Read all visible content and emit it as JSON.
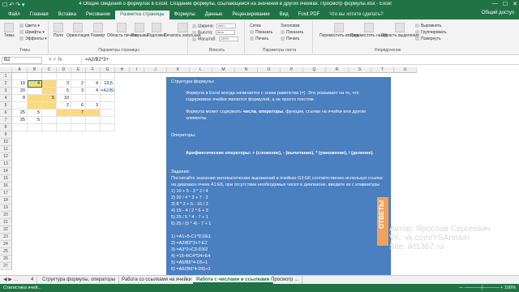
{
  "titlebar": {
    "title": "4 Общие сведения о формулах в Excel. Создание формулы, ссылающейся на значения в других ячейках. Просмотр формулы.xlsx - Excel",
    "quick_access": "☐ ↶ ↷ ▾",
    "min": "—",
    "max": "☐",
    "close": "✕"
  },
  "tabs": [
    "Файл",
    "Главная",
    "Вставка",
    "Рисование",
    "Разметка страницы",
    "Формулы",
    "Данные",
    "Рецензирование",
    "Вид",
    "Foxit PDF",
    "Что вы хотите сделать?"
  ],
  "active_tab_index": 4,
  "share": "Общий доступ",
  "ribbon": {
    "themes": {
      "label": "Темы",
      "buttons": [
        "Темы",
        "Цвета ▾",
        "Шрифты ▾",
        "Эффекты ▾"
      ]
    },
    "page_setup": {
      "label": "Параметры страницы",
      "buttons": [
        "Поля",
        "Ориентация",
        "Размер",
        "Область печати",
        "Разрывы",
        "Подложка",
        "Печатать заголовки"
      ]
    },
    "fit": {
      "label": "Вписать",
      "lines": [
        "Ширина:",
        "Высота:",
        "Масштаб:"
      ],
      "values": [
        "Авто",
        "Авто",
        "100%"
      ]
    },
    "sheet_options": {
      "label": "Параметры листа",
      "col1": [
        "Сетка",
        "Показать",
        "Печать"
      ],
      "col2": [
        "Заголовки",
        "Показать",
        "Печать"
      ]
    },
    "arrange": {
      "label": "Упорядочение",
      "buttons": [
        "Переместить вперед",
        "Переместить назад",
        "Область выделения",
        "Выровнять",
        "Группировать",
        "Повернуть"
      ]
    }
  },
  "formula_bar": {
    "name_box": "B2",
    "fx": "× ✓ fx",
    "formula": "=A2/B2*3+"
  },
  "columns": [
    "A",
    "B",
    "C",
    "D",
    "E",
    "F",
    "G",
    "H",
    "I",
    "J",
    "K",
    "L",
    "M",
    "N",
    "O",
    "P",
    "Q",
    "R",
    "S",
    "T",
    "U"
  ],
  "rows": [
    "1",
    "2",
    "3",
    "4",
    "5",
    "6",
    "7",
    "8",
    "9",
    "10",
    "11",
    "12",
    "13",
    "14",
    "15",
    "16",
    "17",
    "18",
    "19",
    "20",
    "21",
    "22",
    "23",
    "24",
    "25",
    "26",
    "27"
  ],
  "cells": {
    "A2": "10",
    "B2": "4",
    "D2": "3",
    "E2": "2",
    "F2": "4",
    "A3": "20",
    "D3": "5",
    "E3": "3",
    "F3": "4",
    "A4": "8",
    "C4": "5",
    "D4": "10",
    "D5": "2",
    "E5": "6",
    "F5": "3",
    "A6": "25",
    "B6": "5",
    "E6": "7",
    "A7": "25",
    "B7": "5",
    "G2": "13,5",
    "G3": "=A2/B2*3+"
  },
  "panel": {
    "heading": "Структура формулы:",
    "p1a": "Формула в Excel всегда начинается с знака равенства (=). Это указывает на то, что",
    "p1b": "содержимое ячейки является формулой, а не просто текстом.",
    "p2a_pre": "Формула может содержать ",
    "p2a_bold": "числа",
    "p2a_mid": ", ",
    "p2a_bold2": "операторы",
    "p2a_post": ", функции, ссылки на ячейки или другие",
    "p2b": "элементы.",
    "ops_heading": "Операторы:",
    "ops": "Арифметические операторы: + (сложение), - (вычитание), * (умножение), / (деление).",
    "task": "Задание:",
    "task_a": "Посчитайте значения математических выражений в ячейках G3:G6 соответственно используя ссылки",
    "task_b": "на диапазон ячеек A1:E6, при отсутствии необходимых чисел в диапазоне, введите их с клавиатуры",
    "exprs": [
      "1) 10 + 5 - 3 * 2 / 4",
      "2) 20 / 4 * 3 + 7 - 2",
      "3) 8 * 2 + 5 - 10 / 2",
      "4) 15 - 4 / 2 * 6 + 3",
      "5) 25 / 5 * 4 - 7 + 1",
      "6) 25 / (5 * 4) - 7 + 1"
    ],
    "answers": [
      "1) =A1+5-C1*D1/E1",
      "2) =A2/B2*3+7-E2",
      "3) =A3*2+C3-D3/2",
      "4) =15-4/C4*D4+E4",
      "5) =A5/B5*4-D5+1",
      "6) =A6/(B6*4-D6)+1"
    ]
  },
  "watermark": {
    "side": "ОТВЕТЫ",
    "line1": "Автор: Ярослав Сергеевич",
    "line2": "VK: vk.com/YSAniskin",
    "line3": "Site: ikt1367.ru"
  },
  "sheet_tabs": {
    "nav": "◀ ▶ …",
    "items": [
      "4",
      "Структура формулы, операторы",
      "Работа со ссылками на ячейки",
      "Работа с числами и ссылками",
      "Просмотр ..."
    ],
    "active_index": 3
  },
  "status": {
    "ready": "Статистика ячей...",
    "zoom": "— ─────┼───── + 100%"
  }
}
